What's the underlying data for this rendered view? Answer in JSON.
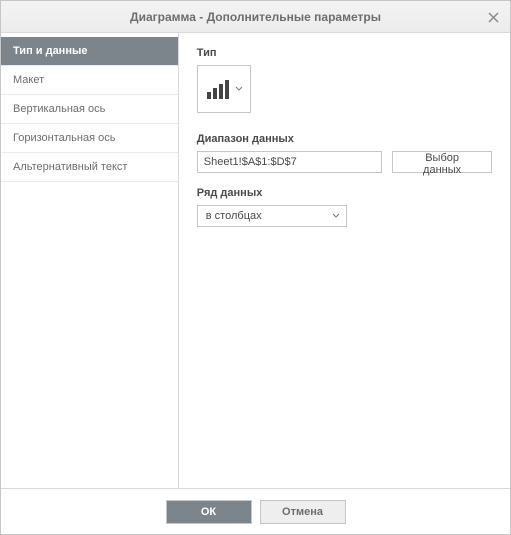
{
  "dialog": {
    "title": "Диаграмма - Дополнительные параметры",
    "close_tooltip": "Close"
  },
  "sidebar": {
    "items": [
      {
        "label": "Тип и данные",
        "id": "type-and-data",
        "active": true
      },
      {
        "label": "Макет",
        "id": "layout",
        "active": false
      },
      {
        "label": "Вертикальная ось",
        "id": "vertical-axis",
        "active": false
      },
      {
        "label": "Горизонтальная ось",
        "id": "horizontal-axis",
        "active": false
      },
      {
        "label": "Альтернативный текст",
        "id": "alt-text",
        "active": false
      }
    ]
  },
  "content": {
    "type_label": "Тип",
    "chart_type": "column",
    "data_range_label": "Диапазон данных",
    "data_range_value": "Sheet1!$A$1:$D$7",
    "select_data_label": "Выбор данных",
    "series_label": "Ряд данных",
    "series_value": "в столбцах"
  },
  "footer": {
    "ok_label": "ОК",
    "cancel_label": "Отмена"
  }
}
